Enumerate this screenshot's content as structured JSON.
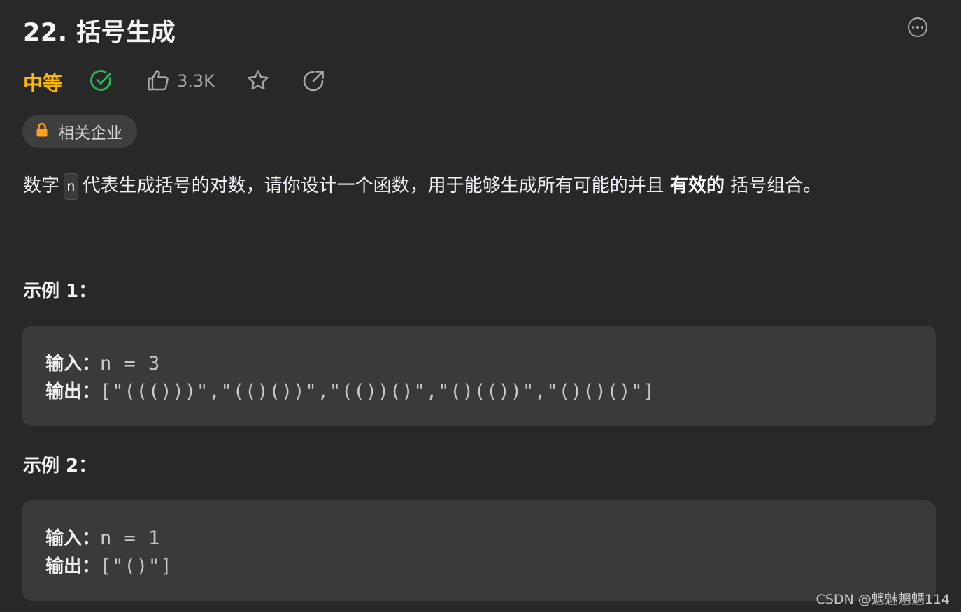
{
  "problem": {
    "title": "22. 括号生成",
    "difficulty": "中等",
    "likes": "3.3K",
    "company_tag": "相关企业"
  },
  "description": {
    "part1": "数字",
    "code": "n",
    "part2": "代表生成括号的对数，请你设计一个函数，用于能够生成所有可能的并且",
    "bold": "有效的",
    "part3": "括号组合。"
  },
  "examples": [
    {
      "heading": "示例 1：",
      "input_label": "输入：",
      "input_value": "n = 3",
      "output_label": "输出：",
      "output_value": "[\"((()))\",\"(()())\",\"(())()\",\"()(())\",\"()()()\"]"
    },
    {
      "heading": "示例 2：",
      "input_label": "输入：",
      "input_value": "n = 1",
      "output_label": "输出：",
      "output_value": "[\"()\"]"
    }
  ],
  "watermark": "CSDN @魑魅魍魉114",
  "colors": {
    "difficulty": "#ffb700",
    "solved_check": "#2db55d",
    "lock": "#ffa116",
    "background": "#282828",
    "code_block": "#3a3a3a"
  },
  "icons": [
    "solved-check-icon",
    "thumbs-up-icon",
    "star-icon",
    "share-icon",
    "more-icon",
    "lock-icon"
  ]
}
